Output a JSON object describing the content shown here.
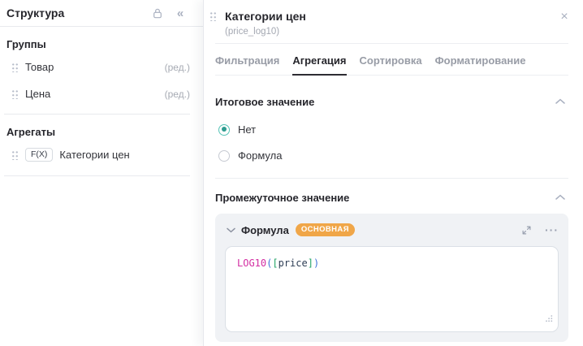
{
  "sidebar": {
    "title": "Структура",
    "collapse_glyph": "«",
    "groups_heading": "Группы",
    "groups": [
      {
        "label": "Товар",
        "edit_label": "(ред.)"
      },
      {
        "label": "Цена",
        "edit_label": "(ред.)"
      }
    ],
    "aggregates_heading": "Агрегаты",
    "aggregates": [
      {
        "badge": "F(X)",
        "label": "Категории цен"
      }
    ]
  },
  "panel": {
    "title": "Категории цен",
    "subtitle": "(price_log10)",
    "close_glyph": "×",
    "tabs": [
      {
        "label": "Фильтрация",
        "active": false
      },
      {
        "label": "Агрегация",
        "active": true
      },
      {
        "label": "Сортировка",
        "active": false
      },
      {
        "label": "Форматирование",
        "active": false
      }
    ],
    "total_section": {
      "heading": "Итоговое значение",
      "options": [
        {
          "label": "Нет",
          "selected": true
        },
        {
          "label": "Формула",
          "selected": false
        }
      ]
    },
    "intermediate_section": {
      "heading": "Промежуточное значение",
      "formula_title": "Формула",
      "badge": "ОСНОВНАЯ",
      "menu_glyph": "···",
      "code": "LOG10([price])",
      "code_tokens": [
        {
          "text": "LOG10",
          "type": "function"
        },
        {
          "text": "(",
          "type": "paren"
        },
        {
          "text": "[",
          "type": "bracket"
        },
        {
          "text": "price",
          "type": "field"
        },
        {
          "text": "]",
          "type": "bracket"
        },
        {
          "text": ")",
          "type": "paren"
        }
      ]
    }
  },
  "colors": {
    "accent_teal": "#2f9c90",
    "badge_orange": "#f0a648",
    "code_function": "#d32ea2",
    "code_paren": "#4174d9",
    "code_bracket": "#23a567",
    "code_field": "#2e3e55",
    "text_dark": "#26262c",
    "text_gray": "#989ca6",
    "card_bg": "#f0f2f5"
  }
}
